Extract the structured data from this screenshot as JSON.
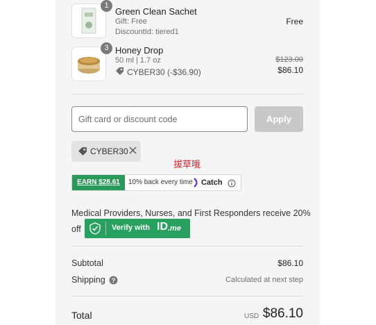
{
  "items": [
    {
      "quantity": "1",
      "name": "Green Clean Sachet",
      "line1": "Gift: Free",
      "line2": "DiscountId: tiered1",
      "price": "Free"
    },
    {
      "quantity": "3",
      "name": "Honey Drop",
      "line1": "50 ml | 1.7 oz",
      "discount": "CYBER30 (-$36.90)",
      "original_price": "$123.00",
      "price": "$86.10"
    }
  ],
  "discount_input": {
    "placeholder": "Gift card or discount code",
    "apply_label": "Apply"
  },
  "applied_code": {
    "label": "CYBER30"
  },
  "annotation": "拔草哦",
  "catch": {
    "earn_label": "EARN $28.61",
    "text": "10% back every time",
    "brand": "Catch"
  },
  "idme": {
    "text_part1": "Medical Providers, Nurses, and First Responders receive 20%",
    "text_part2": "off",
    "button_label": "Verify with",
    "brand_id": "ID",
    "brand_me": ".me"
  },
  "summary": {
    "subtotal_label": "Subtotal",
    "subtotal_value": "$86.10",
    "shipping_label": "Shipping",
    "shipping_value": "Calculated at next step",
    "total_label": "Total",
    "currency": "USD",
    "total_value": "$86.10"
  },
  "colors": {
    "earn_green": "#2a9a5a",
    "idme_green": "#27a060",
    "annotation_red": "#e0202a",
    "catch_purple": "#6a2bd6"
  }
}
